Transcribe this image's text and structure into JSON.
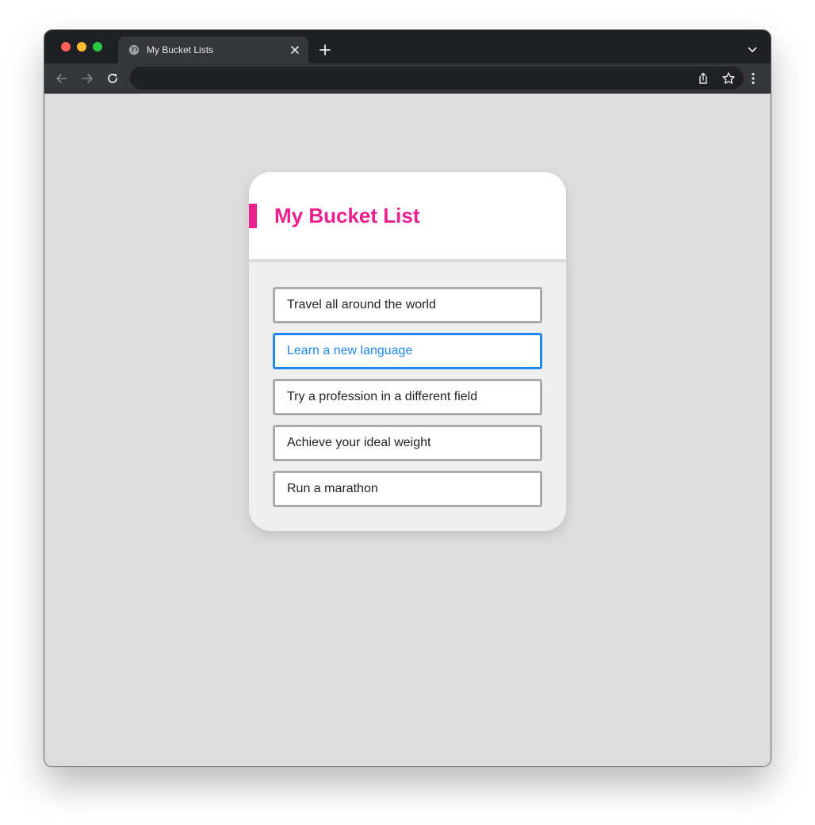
{
  "browser": {
    "tab_title": "My Bucket Lists",
    "address_value": ""
  },
  "icons": {
    "favicon": "globe-icon",
    "tab_close": "close-icon",
    "new_tab": "plus-icon",
    "tab_menu": "chevron-down-icon",
    "back": "arrow-left-icon",
    "forward": "arrow-right-icon",
    "reload": "reload-icon",
    "share": "share-icon",
    "bookmark": "star-icon",
    "menu": "kebab-menu-icon"
  },
  "colors": {
    "accent": "#f01e8c",
    "active_item": "#1e88f0",
    "page_background": "#dddddd",
    "card_body": "#efefef"
  },
  "card": {
    "title": "My Bucket List",
    "items": [
      {
        "label": "Travel all around the world",
        "active": false
      },
      {
        "label": "Learn a new language",
        "active": true
      },
      {
        "label": "Try a profession in a different field",
        "active": false
      },
      {
        "label": "Achieve your ideal weight",
        "active": false
      },
      {
        "label": "Run a marathon",
        "active": false
      }
    ]
  }
}
